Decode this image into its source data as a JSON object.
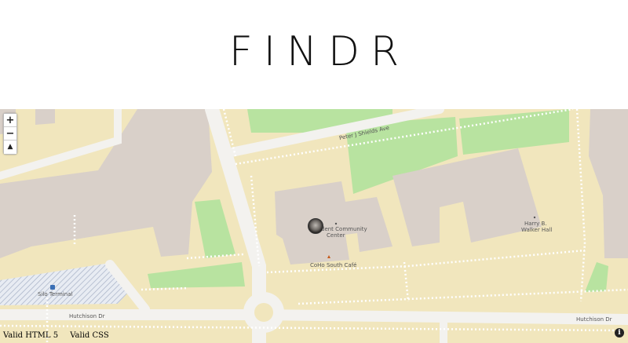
{
  "app": {
    "title": "FINDR"
  },
  "map": {
    "zoom_in": "+",
    "zoom_out": "−",
    "reset_bearing": "▲",
    "attribution": "i",
    "labels": {
      "street_top": "Peter J Shields Ave",
      "street_bottom_left": "Hutchison Dr",
      "street_bottom_right": "Hutchison Dr",
      "building_main_1": "dent Community",
      "building_main_2": "Center",
      "building_right_1": "Harry B.",
      "building_right_2": "Walker Hall",
      "cafe": "CoHo South Café",
      "silo": "Silo Terminal"
    },
    "colors": {
      "land": "#f1e6bd",
      "building": "#d9d0c9",
      "park": "#b8e3a0",
      "road": "#f3f2ef",
      "path_dots": "#ffffff"
    }
  },
  "footer": {
    "html5": "Valid HTML 5",
    "css": "Valid CSS"
  }
}
